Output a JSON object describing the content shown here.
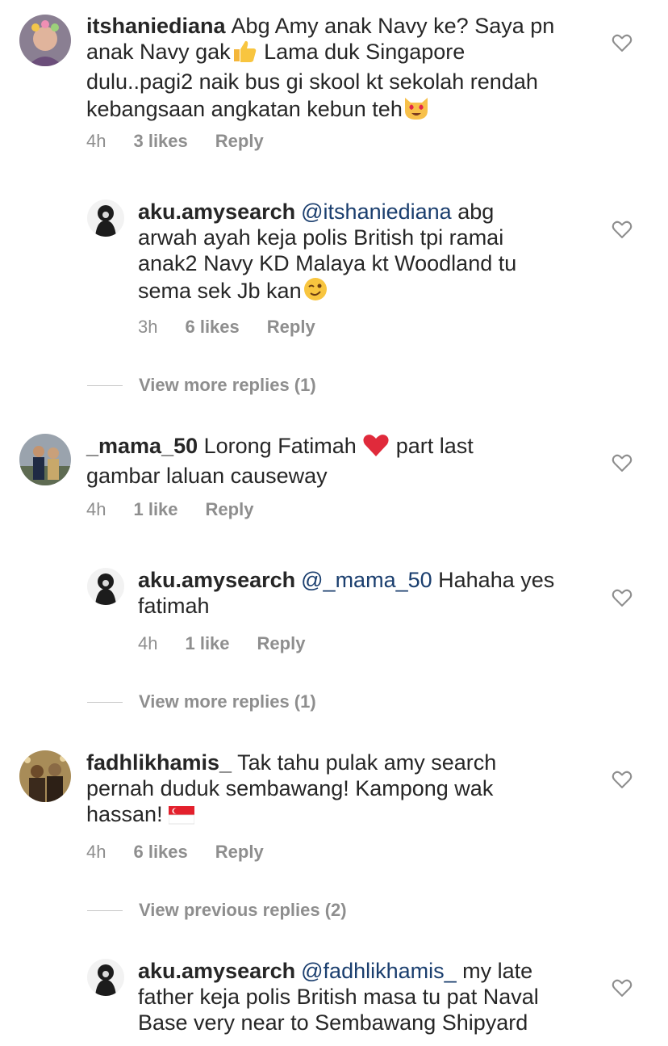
{
  "heart_icon": "heart-outline-icon",
  "comments": [
    {
      "username": "itshaniediana",
      "text_lines": [
        "Abg Amy anak Navy ke? Saya pn",
        "anak Navy gak",
        " Lama duk Singapore",
        "dulu..pagi2 naik bus gi skool kt sekolah rendah",
        "kebangsaan angkatan kebun teh"
      ],
      "time": "4h",
      "likes": "3 likes",
      "reply": "Reply"
    },
    {
      "username": "aku.amysearch",
      "mention": "@itshaniediana",
      "text_lines": [
        " abg",
        "arwah ayah keja polis British tpi ramai",
        "anak2 Navy KD Malaya kt Woodland tu",
        "sema sek Jb kan"
      ],
      "time": "3h",
      "likes": "6 likes",
      "reply": "Reply"
    },
    {
      "view_more": "View more replies (1)"
    },
    {
      "username": "_mama_50",
      "text_lines": [
        " Lorong Fatimah ",
        " part last",
        "gambar laluan causeway"
      ],
      "time": "4h",
      "likes": "1 like",
      "reply": "Reply"
    },
    {
      "username": "aku.amysearch",
      "mention": "@_mama_50",
      "text_lines": [
        " Hahaha yes",
        "fatimah"
      ],
      "time": "4h",
      "likes": "1 like",
      "reply": "Reply"
    },
    {
      "view_more": "View more replies (1)"
    },
    {
      "username": "fadhlikhamis_",
      "text_lines": [
        " Tak tahu pulak amy search",
        "pernah duduk sembawang! Kampong wak",
        "hassan! "
      ],
      "time": "4h",
      "likes": "6 likes",
      "reply": "Reply"
    },
    {
      "view_more": "View previous replies (2)"
    },
    {
      "username": "aku.amysearch",
      "mention": "@fadhlikhamis_",
      "text_lines": [
        " my late",
        "father keja polis British masa tu pat Naval",
        "Base very near to Sembawang Shipyard"
      ]
    }
  ]
}
